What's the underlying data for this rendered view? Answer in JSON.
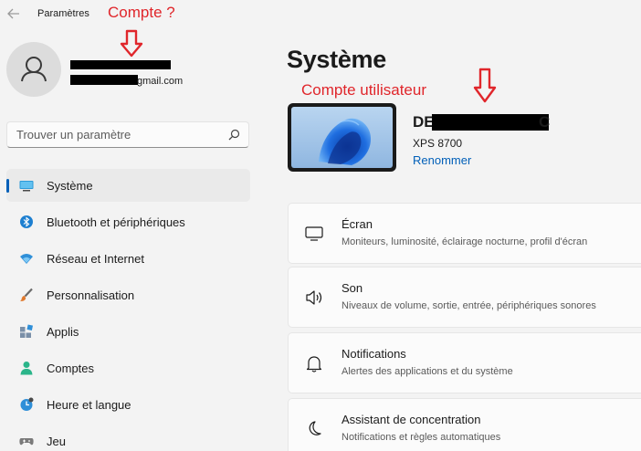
{
  "window": {
    "title": "Paramètres",
    "back_icon": "back-arrow-icon"
  },
  "annotations": {
    "account": "Compte ?",
    "user_account": "Compte utilisateur",
    "color": "#e0262b"
  },
  "account": {
    "avatar_icon": "person-icon",
    "email_suffix": "gmail.com"
  },
  "search": {
    "placeholder": "Trouver un paramètre",
    "icon": "search-icon"
  },
  "sidebar": {
    "accent": "#005fb8",
    "items": [
      {
        "label": "Système",
        "icon": "system-display-icon",
        "active": true
      },
      {
        "label": "Bluetooth et périphériques",
        "icon": "bluetooth-icon"
      },
      {
        "label": "Réseau et Internet",
        "icon": "wifi-icon"
      },
      {
        "label": "Personnalisation",
        "icon": "brush-icon"
      },
      {
        "label": "Applis",
        "icon": "apps-icon"
      },
      {
        "label": "Comptes",
        "icon": "account-icon"
      },
      {
        "label": "Heure et langue",
        "icon": "clock-globe-icon"
      },
      {
        "label": "Jeu",
        "icon": "gamepad-icon"
      }
    ]
  },
  "main": {
    "title": "Système",
    "device": {
      "name_prefix": "DE",
      "name_suffix": "C",
      "model": "XPS 8700",
      "rename_label": "Renommer"
    },
    "cards": [
      {
        "title": "Écran",
        "desc": "Moniteurs, luminosité, éclairage nocturne, profil d'écran",
        "icon": "monitor-icon"
      },
      {
        "title": "Son",
        "desc": "Niveaux de volume, sortie, entrée, périphériques sonores",
        "icon": "speaker-icon"
      },
      {
        "title": "Notifications",
        "desc": "Alertes des applications et du système",
        "icon": "bell-icon"
      },
      {
        "title": "Assistant de concentration",
        "desc": "Notifications et règles automatiques",
        "icon": "moon-icon"
      }
    ]
  }
}
